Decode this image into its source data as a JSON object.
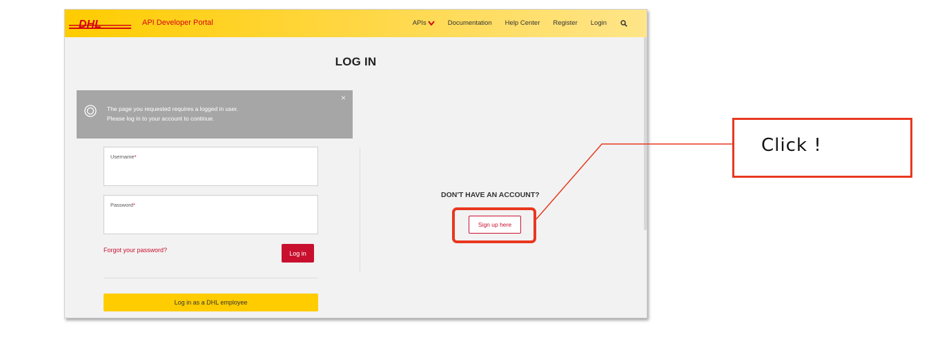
{
  "header": {
    "logo_text": "DHL",
    "portal_title": "API Developer Portal",
    "nav": [
      {
        "label": "APIs"
      },
      {
        "label": "Documentation"
      },
      {
        "label": "Help Center"
      },
      {
        "label": "Register"
      },
      {
        "label": "Login"
      }
    ]
  },
  "page": {
    "title": "LOG IN"
  },
  "alert": {
    "line1": "The page you requested requires a logged in user.",
    "line2": "Please log in to your account to continue.",
    "close": "×"
  },
  "form": {
    "username_label": "Username",
    "password_label": "Password",
    "required_marker": "*",
    "forgot": "Forgot your password?",
    "login_button": "Log in",
    "employee_button": "Log in as a DHL employee"
  },
  "signup": {
    "prompt": "DON'T HAVE AN ACCOUNT?",
    "button": "Sign up here"
  },
  "annotation": {
    "callout": "Click !",
    "color": "#e8371f"
  },
  "colors": {
    "dhl_yellow": "#ffcc00",
    "dhl_red": "#d40511"
  }
}
